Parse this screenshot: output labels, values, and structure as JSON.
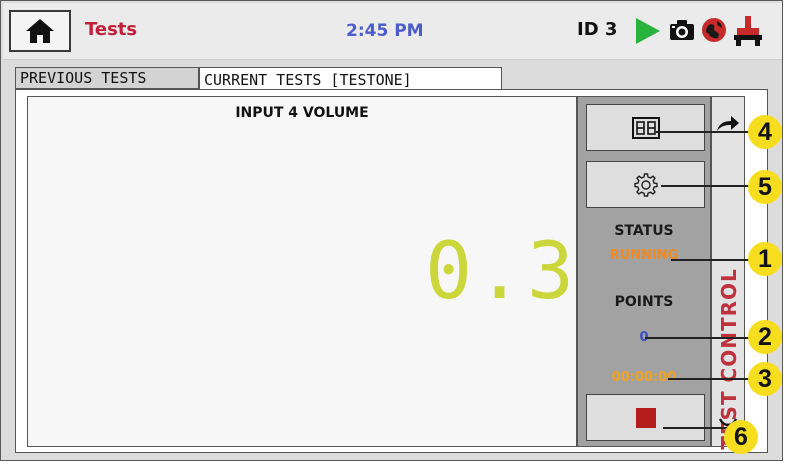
{
  "topbar": {
    "title": "Tests",
    "clock": "2:45 PM",
    "device_id": "ID 3",
    "icons": [
      "home-icon",
      "play-icon",
      "camera-icon",
      "network-icon",
      "usb-icon"
    ]
  },
  "tabs": [
    {
      "label": "PREVIOUS TESTS",
      "active": false
    },
    {
      "label": "CURRENT TESTS [TESTONE]",
      "active": true
    }
  ],
  "display": {
    "label": "INPUT 4 VOLUME",
    "value": "0.3"
  },
  "side_panel": {
    "layout_button_icon": "grid-icon",
    "settings_button_icon": "gear-icon",
    "status_label": "STATUS",
    "status_value": "RUNNING",
    "points_label": "POINTS",
    "points_value": "0",
    "elapsed_time": "00:00:00",
    "stop_button_icon": "stop-icon"
  },
  "test_control": {
    "label": "TEST CONTROL"
  },
  "callouts": [
    "4",
    "5",
    "1",
    "2",
    "3",
    "6"
  ],
  "colors": {
    "title": "#c2203a",
    "clock": "#4b5bd0",
    "status_running": "#f08a24",
    "points": "#3a4fc0",
    "elapsed": "#f0a020",
    "big_value": "#cbd63a",
    "test_control": "#c0313e",
    "callout": "#f6dd1e",
    "stop": "#b51c1c"
  }
}
